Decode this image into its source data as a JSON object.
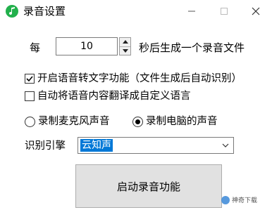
{
  "window": {
    "title": "录音设置",
    "icon": "music-note-icon",
    "controls": [
      "minimize-icon",
      "maximize-icon",
      "close-icon"
    ]
  },
  "interval": {
    "prefix": "每",
    "value": "10",
    "suffix": "秒后生成一个录音文件"
  },
  "options": {
    "speech_to_text": {
      "label": "开启语音转文字功能（文件生成后自动识别）",
      "checked": true
    },
    "translate": {
      "label": "自动将语音内容翻译成自定义语言",
      "checked": false
    }
  },
  "source": {
    "microphone": {
      "label": "录制麦克风声音",
      "selected": false
    },
    "computer": {
      "label": "录制电脑的声音",
      "selected": true
    }
  },
  "engine": {
    "label": "识别引擎",
    "value": "云知声"
  },
  "start_button": {
    "label": "启动录音功能"
  },
  "watermark": {
    "text": "神奇下载"
  },
  "colors": {
    "app_icon": "#22b04c",
    "selection": "#0078d7",
    "button_bg": "#e1e1e1"
  }
}
